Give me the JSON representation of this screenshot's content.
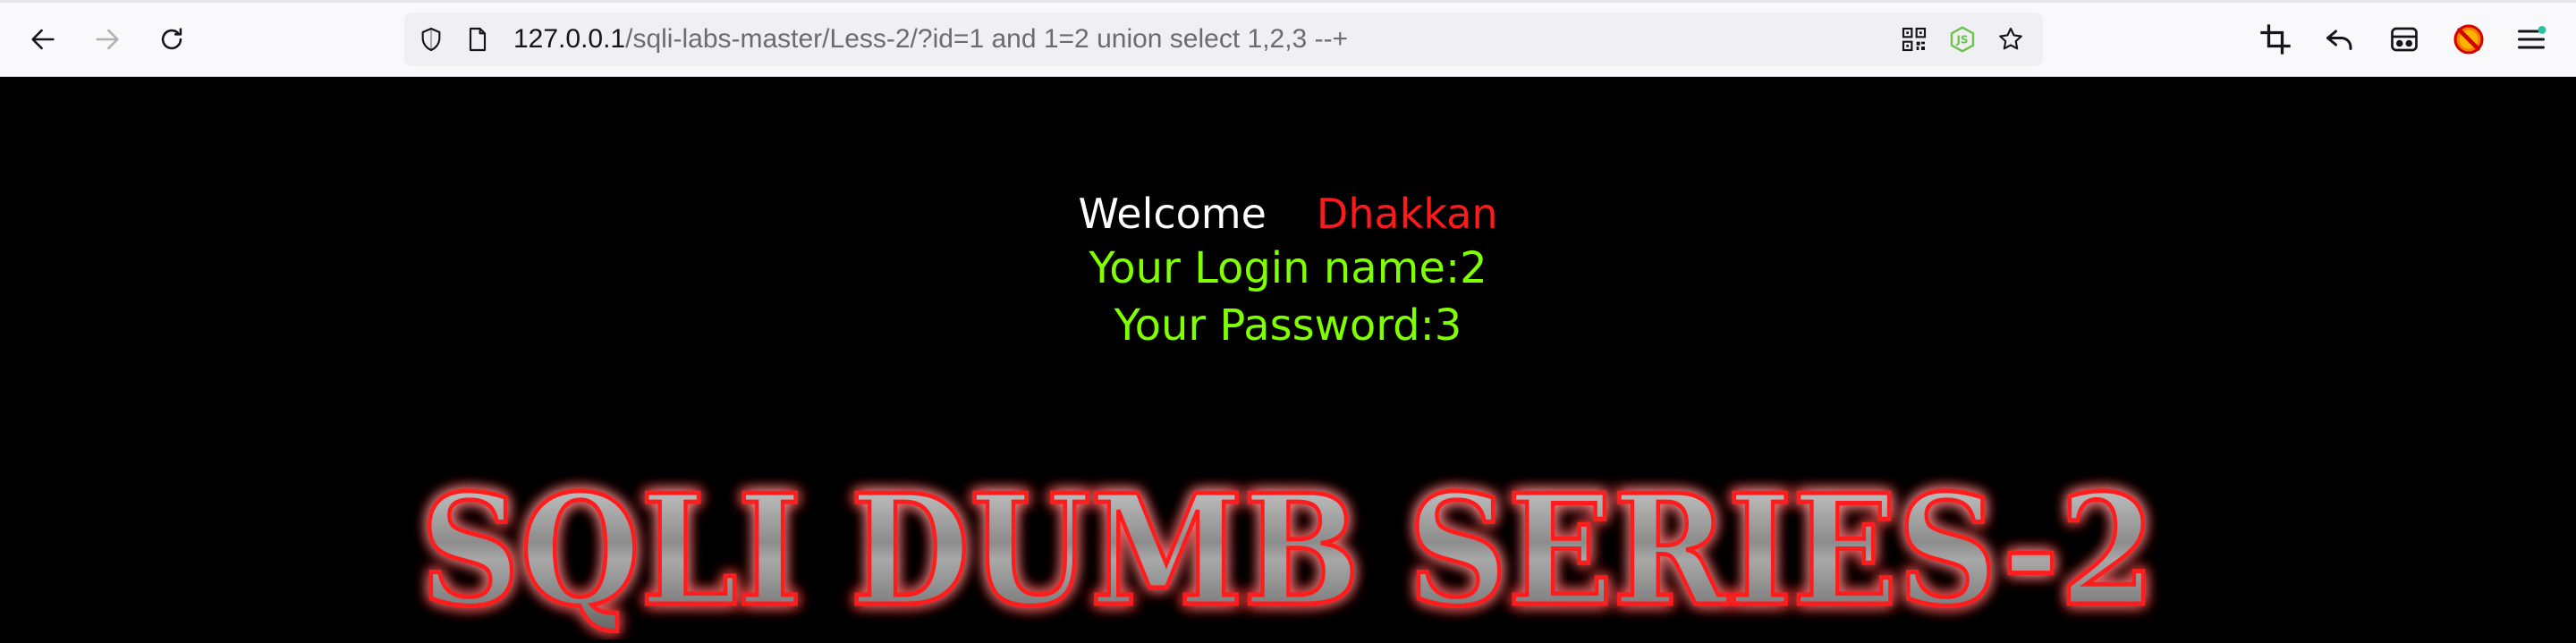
{
  "browser": {
    "url": {
      "host": "127.0.0.1",
      "path": "/sqli-labs-master/Less-2/?id=1 and 1=2 union select 1,2,3 --+"
    },
    "icons": {
      "back": "back-arrow-icon",
      "forward": "forward-arrow-icon",
      "reload": "reload-icon",
      "shield": "tracking-protection-shield-icon",
      "page": "page-info-icon",
      "qr": "qr-code-icon",
      "js": "nodejs-extension-icon",
      "bookmark": "bookmark-star-icon",
      "crop": "screenshot-crop-icon",
      "undo": "undo-icon",
      "container": "container-tab-icon",
      "blocker": "blocker-extension-icon",
      "menu": "app-menu-icon"
    }
  },
  "page": {
    "welcome_label": "Welcome",
    "user_name": "Dhakkan",
    "login_line": "Your Login name:2",
    "password_line": "Your Password:3",
    "banner_title": "SQLI DUMB SERIES-2"
  },
  "colors": {
    "background": "#000000",
    "welcome": "#ffffff",
    "user_name": "#ff1a1a",
    "info_text": "#7fff00",
    "banner_glow": "#ff0000",
    "banner_fill": "#9a9a9a"
  }
}
